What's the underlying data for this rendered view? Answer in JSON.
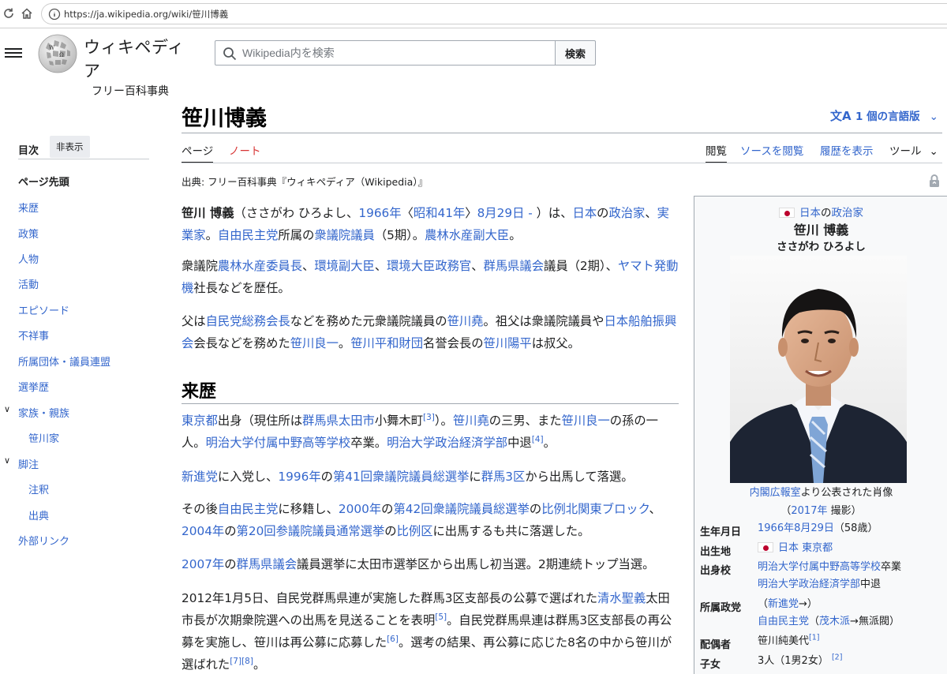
{
  "browser": {
    "url": "https://ja.wikipedia.org/wiki/笹川博義"
  },
  "header": {
    "wordmark_title": "ウィキペディア",
    "wordmark_tagline": "フリー百科事典",
    "search_placeholder": "Wikipedia内を検索",
    "search_button": "検索"
  },
  "title": "笹川博義",
  "languages": "1 個の言語版",
  "tabs": {
    "page": "ページ",
    "talk": "ノート",
    "read": "閲覧",
    "source": "ソースを閲覧",
    "history": "履歴を表示",
    "tools": "ツール"
  },
  "from_line": "出典: フリー百科事典『ウィキペディア（Wikipedia）』",
  "toc": {
    "title": "目次",
    "hide": "非表示",
    "items": [
      "ページ先頭",
      "来歴",
      "政策",
      "人物",
      "活動",
      "エピソード",
      "不祥事",
      "所属団体・議員連盟",
      "選挙歴",
      "家族・親族",
      "笹川家",
      "脚注",
      "注釈",
      "出典",
      "外部リンク"
    ]
  },
  "article": {
    "lead1": {
      "name": "笹川 博義",
      "t1": "（ささがわ ひろよし、",
      "y": "1966年",
      "t2": "〈",
      "era": "昭和41年",
      "t3": "〉",
      "d": "8月29日 -",
      "t4": " ）は、",
      "jp": "日本",
      "t5": "の",
      "pol": "政治家",
      "t6": "、",
      "biz": "実業家",
      "t7": "。",
      "ldp": "自由民主党",
      "t8": "所属の",
      "hr": "衆議院議員",
      "t9": "（5期）。",
      "vice": "農林水産副大臣",
      "t10": "。"
    },
    "lead2": {
      "t0": "衆議院",
      "a": "農林水産委員長",
      "s1": "、",
      "b": "環境副大臣",
      "s2": "、",
      "c": "環境大臣政務官",
      "s3": "、",
      "d": "群馬県議会",
      "t1": "議員（2期）、",
      "e": "ヤマト発動機",
      "t2": "社長などを歴任。"
    },
    "lead3": {
      "t0": "父は",
      "a": "自民党総務会長",
      "t1": "などを務めた元衆議院議員の",
      "b": "笹川堯",
      "t2": "。祖父は衆議院議員や",
      "c": "日本船舶振興会",
      "t3": "会長などを務めた",
      "d": "笹川良一",
      "t4": "。",
      "e": "笹川平和財団",
      "t5": "名誉会長の",
      "f": "笹川陽平",
      "t6": "は叔父。"
    },
    "h2_career": "来歴",
    "p1": {
      "a": "東京都",
      "t1": "出身（現住所は",
      "b": "群馬県",
      "c": "太田市",
      "t2": "小舞木町",
      "r3": "[3]",
      "t3": "）。",
      "d": "笹川堯",
      "t4": "の三男、また",
      "e": "笹川良一",
      "t5": "の孫の一人。",
      "f": "明治大学付属中野高等学校",
      "t6": "卒業。",
      "g": "明治大学政治経済学部",
      "t7": "中退",
      "r4": "[4]",
      "t8": "。"
    },
    "p2": {
      "a": "新進党",
      "t1": "に入党し、",
      "b": "1996年",
      "t2": "の",
      "c": "第41回衆議院議員総選挙",
      "t3": "に",
      "d": "群馬3区",
      "t4": "から出馬して落選。"
    },
    "p3": {
      "t0": "その後",
      "a": "自由民主党",
      "t1": "に移籍し、",
      "b": "2000年",
      "t2": "の",
      "c": "第42回衆議院議員総選挙",
      "t3": "の",
      "d": "比例北関東ブロック",
      "t4": "、",
      "e": "2004年",
      "t5": "の",
      "f": "第20回参議院議員通常選挙",
      "t6": "の",
      "g": "比例区",
      "t7": "に出馬するも共に落選した。"
    },
    "p4": {
      "a": "2007年",
      "t1": "の",
      "b": "群馬県議会",
      "t2": "議員選挙に太田市選挙区から出馬し初当選。2期連続トップ当選。"
    },
    "p5": {
      "t0": "2012年1月5日、自民党群馬県連が実施した群馬3区支部長の公募で選ばれた",
      "a": "清水聖義",
      "t1": "太田市長が次期衆院選への出馬を見送ることを表明",
      "r5": "[5]",
      "t2": "。自民党群馬県連は群馬3区支部長の再公募を実施し、笹川は再公募に応募した",
      "r6": "[6]",
      "t3": "。選考の結果、再公募に応じた8名の中から笹川が選ばれた",
      "r7": "[7]",
      "r8": "[8]",
      "t4": "。"
    }
  },
  "infobox": {
    "nation": "日本",
    "of": "の",
    "role": "政治家",
    "name": "笹川 博義",
    "kana": "ささがわ ひろよし",
    "caption1_link": "内閣広報室",
    "caption1_rest": "より公表された肖像",
    "caption2_open": "（",
    "caption2_year": "2017年",
    "caption2_rest": " 撮影）",
    "rows": {
      "birthdate_label": "生年月日",
      "birthdate": "1966年8月29日",
      "age": "（58歳）",
      "birthplace_label": "出生地",
      "birthplace_country": "日本",
      "birthplace_city": "東京都",
      "school_label": "出身校",
      "school1": "明治大学付属中野高等学校",
      "school1_rest": "卒業",
      "school2": "明治大学政治経済学部",
      "school2_rest": "中退",
      "party_label": "所属政党",
      "party1_open": "（",
      "party1": "新進党",
      "party1_close": "→）",
      "party2": "自由民主党",
      "party2_open": "（",
      "party2_faction": "茂木派",
      "party2_rest": "→無派閥）",
      "spouse_label": "配偶者",
      "spouse": "笹川純美代",
      "spouse_ref": "[1]",
      "children_label": "子女",
      "children": "3人（1男2女）",
      "children_ref": "[2]"
    }
  }
}
